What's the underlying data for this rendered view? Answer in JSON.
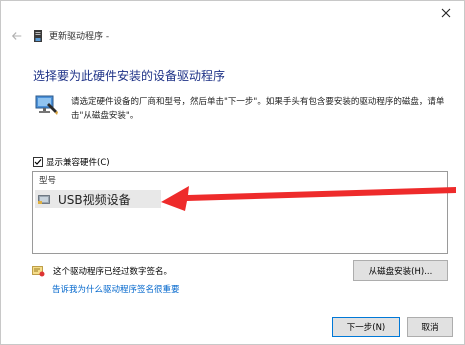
{
  "title_bar": {
    "close_icon": "close-icon"
  },
  "nav": {
    "back_icon": "back-arrow-icon",
    "title": "更新驱动程序 -"
  },
  "heading": "选择要为此硬件安装的设备驱动程序",
  "description": "请选定硬件设备的厂商和型号，然后单击\"下一步\"。如果手头有包含要安装的驱动程序的磁盘，请单击\"从磁盘安装\"。",
  "compat": {
    "label": "显示兼容硬件(C)",
    "checked": true
  },
  "model_list": {
    "header": "型号",
    "items": [
      "USB视频设备"
    ]
  },
  "signature": {
    "text": "这个驱动程序已经过数字签名。",
    "link": "告诉我为什么驱动程序签名很重要"
  },
  "buttons": {
    "have_disk": "从磁盘安装(H)...",
    "next": "下一步(N)",
    "cancel": "取消"
  },
  "colors": {
    "heading": "#1e3287",
    "link": "#0066cc",
    "arrow": "#ee2b2b"
  }
}
